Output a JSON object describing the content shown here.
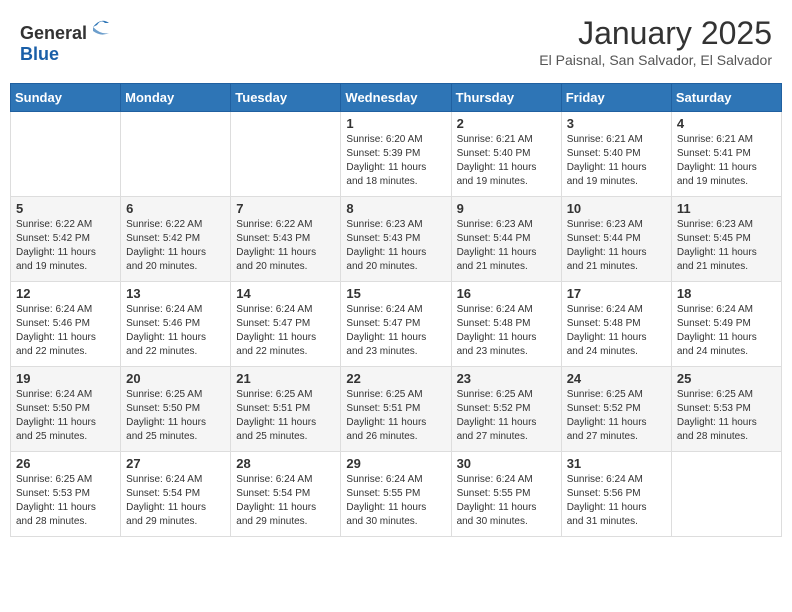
{
  "header": {
    "logo_general": "General",
    "logo_blue": "Blue",
    "month_title": "January 2025",
    "location": "El Paisnal, San Salvador, El Salvador"
  },
  "weekdays": [
    "Sunday",
    "Monday",
    "Tuesday",
    "Wednesday",
    "Thursday",
    "Friday",
    "Saturday"
  ],
  "weeks": [
    [
      {
        "day": "",
        "info": ""
      },
      {
        "day": "",
        "info": ""
      },
      {
        "day": "",
        "info": ""
      },
      {
        "day": "1",
        "info": "Sunrise: 6:20 AM\nSunset: 5:39 PM\nDaylight: 11 hours and 18 minutes."
      },
      {
        "day": "2",
        "info": "Sunrise: 6:21 AM\nSunset: 5:40 PM\nDaylight: 11 hours and 19 minutes."
      },
      {
        "day": "3",
        "info": "Sunrise: 6:21 AM\nSunset: 5:40 PM\nDaylight: 11 hours and 19 minutes."
      },
      {
        "day": "4",
        "info": "Sunrise: 6:21 AM\nSunset: 5:41 PM\nDaylight: 11 hours and 19 minutes."
      }
    ],
    [
      {
        "day": "5",
        "info": "Sunrise: 6:22 AM\nSunset: 5:42 PM\nDaylight: 11 hours and 19 minutes."
      },
      {
        "day": "6",
        "info": "Sunrise: 6:22 AM\nSunset: 5:42 PM\nDaylight: 11 hours and 20 minutes."
      },
      {
        "day": "7",
        "info": "Sunrise: 6:22 AM\nSunset: 5:43 PM\nDaylight: 11 hours and 20 minutes."
      },
      {
        "day": "8",
        "info": "Sunrise: 6:23 AM\nSunset: 5:43 PM\nDaylight: 11 hours and 20 minutes."
      },
      {
        "day": "9",
        "info": "Sunrise: 6:23 AM\nSunset: 5:44 PM\nDaylight: 11 hours and 21 minutes."
      },
      {
        "day": "10",
        "info": "Sunrise: 6:23 AM\nSunset: 5:44 PM\nDaylight: 11 hours and 21 minutes."
      },
      {
        "day": "11",
        "info": "Sunrise: 6:23 AM\nSunset: 5:45 PM\nDaylight: 11 hours and 21 minutes."
      }
    ],
    [
      {
        "day": "12",
        "info": "Sunrise: 6:24 AM\nSunset: 5:46 PM\nDaylight: 11 hours and 22 minutes."
      },
      {
        "day": "13",
        "info": "Sunrise: 6:24 AM\nSunset: 5:46 PM\nDaylight: 11 hours and 22 minutes."
      },
      {
        "day": "14",
        "info": "Sunrise: 6:24 AM\nSunset: 5:47 PM\nDaylight: 11 hours and 22 minutes."
      },
      {
        "day": "15",
        "info": "Sunrise: 6:24 AM\nSunset: 5:47 PM\nDaylight: 11 hours and 23 minutes."
      },
      {
        "day": "16",
        "info": "Sunrise: 6:24 AM\nSunset: 5:48 PM\nDaylight: 11 hours and 23 minutes."
      },
      {
        "day": "17",
        "info": "Sunrise: 6:24 AM\nSunset: 5:48 PM\nDaylight: 11 hours and 24 minutes."
      },
      {
        "day": "18",
        "info": "Sunrise: 6:24 AM\nSunset: 5:49 PM\nDaylight: 11 hours and 24 minutes."
      }
    ],
    [
      {
        "day": "19",
        "info": "Sunrise: 6:24 AM\nSunset: 5:50 PM\nDaylight: 11 hours and 25 minutes."
      },
      {
        "day": "20",
        "info": "Sunrise: 6:25 AM\nSunset: 5:50 PM\nDaylight: 11 hours and 25 minutes."
      },
      {
        "day": "21",
        "info": "Sunrise: 6:25 AM\nSunset: 5:51 PM\nDaylight: 11 hours and 25 minutes."
      },
      {
        "day": "22",
        "info": "Sunrise: 6:25 AM\nSunset: 5:51 PM\nDaylight: 11 hours and 26 minutes."
      },
      {
        "day": "23",
        "info": "Sunrise: 6:25 AM\nSunset: 5:52 PM\nDaylight: 11 hours and 27 minutes."
      },
      {
        "day": "24",
        "info": "Sunrise: 6:25 AM\nSunset: 5:52 PM\nDaylight: 11 hours and 27 minutes."
      },
      {
        "day": "25",
        "info": "Sunrise: 6:25 AM\nSunset: 5:53 PM\nDaylight: 11 hours and 28 minutes."
      }
    ],
    [
      {
        "day": "26",
        "info": "Sunrise: 6:25 AM\nSunset: 5:53 PM\nDaylight: 11 hours and 28 minutes."
      },
      {
        "day": "27",
        "info": "Sunrise: 6:24 AM\nSunset: 5:54 PM\nDaylight: 11 hours and 29 minutes."
      },
      {
        "day": "28",
        "info": "Sunrise: 6:24 AM\nSunset: 5:54 PM\nDaylight: 11 hours and 29 minutes."
      },
      {
        "day": "29",
        "info": "Sunrise: 6:24 AM\nSunset: 5:55 PM\nDaylight: 11 hours and 30 minutes."
      },
      {
        "day": "30",
        "info": "Sunrise: 6:24 AM\nSunset: 5:55 PM\nDaylight: 11 hours and 30 minutes."
      },
      {
        "day": "31",
        "info": "Sunrise: 6:24 AM\nSunset: 5:56 PM\nDaylight: 11 hours and 31 minutes."
      },
      {
        "day": "",
        "info": ""
      }
    ]
  ]
}
